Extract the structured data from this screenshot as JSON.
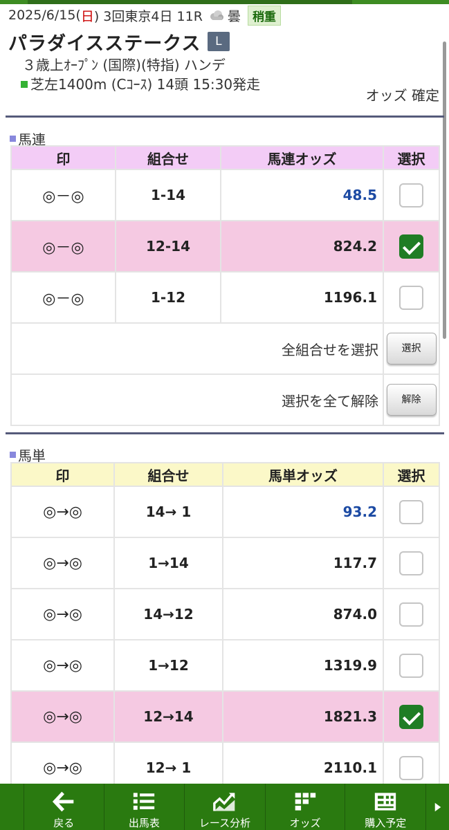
{
  "race": {
    "date_prefix": "2025/6/15(",
    "day_of_week": "日",
    "date_suffix": ") 3回東京4日 11R",
    "weather": "曇",
    "weather_icon": "cloud-icon",
    "track_condition": "稍重",
    "name": "パラダイスステークス",
    "grade": "L",
    "conditions": "３歳上ｵｰﾌﾟﾝ (国際)(特指) ハンデ",
    "course": "芝左1400m (Cｺｰｽ) 14頭 15:30発走",
    "odds_status": "オッズ 確定"
  },
  "umaren": {
    "title": "馬連",
    "headers": [
      "印",
      "組合せ",
      "馬連オッズ",
      "選択"
    ],
    "rows": [
      {
        "mark": "◎－◎",
        "combo": "1-14",
        "odds": "48.5",
        "selected": false,
        "favorite": true
      },
      {
        "mark": "◎－◎",
        "combo": "12-14",
        "odds": "824.2",
        "selected": true,
        "favorite": false
      },
      {
        "mark": "◎－◎",
        "combo": "1-12",
        "odds": "1196.1",
        "selected": false,
        "favorite": false
      }
    ],
    "select_all_label": "全組合せを選択",
    "select_all_button": "選択",
    "clear_all_label": "選択を全て解除",
    "clear_all_button": "解除"
  },
  "umatan": {
    "title": "馬単",
    "headers": [
      "印",
      "組合せ",
      "馬単オッズ",
      "選択"
    ],
    "rows": [
      {
        "mark": "◎→◎",
        "combo": "14→ 1",
        "odds": "93.2",
        "selected": false,
        "favorite": true
      },
      {
        "mark": "◎→◎",
        "combo": "1→14",
        "odds": "117.7",
        "selected": false,
        "favorite": false
      },
      {
        "mark": "◎→◎",
        "combo": "14→12",
        "odds": "874.0",
        "selected": false,
        "favorite": false
      },
      {
        "mark": "◎→◎",
        "combo": "1→12",
        "odds": "1319.9",
        "selected": false,
        "favorite": false
      },
      {
        "mark": "◎→◎",
        "combo": "12→14",
        "odds": "1821.3",
        "selected": true,
        "favorite": false
      },
      {
        "mark": "◎→◎",
        "combo": "12→ 1",
        "odds": "2110.1",
        "selected": false,
        "favorite": false
      }
    ]
  },
  "tabs": [
    {
      "label": "戻る",
      "icon": "back-arrow-icon"
    },
    {
      "label": "出馬表",
      "icon": "list-icon"
    },
    {
      "label": "レース分析",
      "icon": "analysis-chart-icon"
    },
    {
      "label": "オッズ",
      "icon": "odds-grid-icon"
    },
    {
      "label": "購入予定",
      "icon": "purchase-plan-icon"
    }
  ],
  "colors": {
    "header_bar": "#2a7a10",
    "umaren_header": "#f3ccf6",
    "umatan_header": "#fbf8c8",
    "selected_row": "#f5c9e2",
    "favorite_odds": "#1c4aa3",
    "checkbox_on": "#1f7d25"
  }
}
